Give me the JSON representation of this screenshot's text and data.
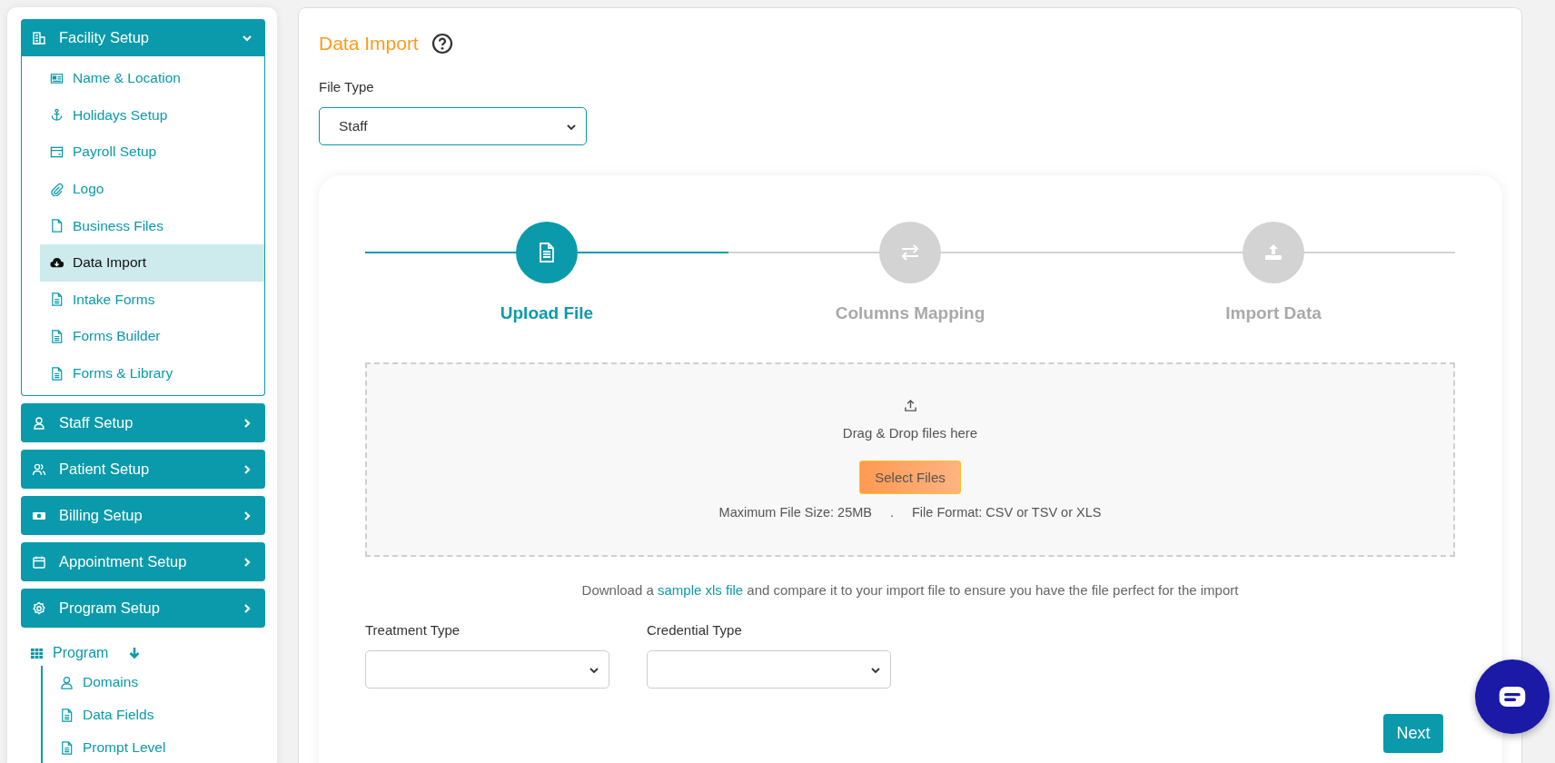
{
  "sidebar": {
    "sections": [
      {
        "label": "Facility Setup",
        "expanded": true,
        "items": [
          {
            "label": "Name & Location",
            "selected": false
          },
          {
            "label": "Holidays Setup",
            "selected": false
          },
          {
            "label": "Payroll Setup",
            "selected": false
          },
          {
            "label": "Logo",
            "selected": false
          },
          {
            "label": "Business Files",
            "selected": false
          },
          {
            "label": "Data Import",
            "selected": true
          },
          {
            "label": "Intake Forms",
            "selected": false
          },
          {
            "label": "Forms Builder",
            "selected": false
          },
          {
            "label": "Forms & Library",
            "selected": false
          }
        ]
      },
      {
        "label": "Staff Setup",
        "expanded": false
      },
      {
        "label": "Patient Setup",
        "expanded": false
      },
      {
        "label": "Billing Setup",
        "expanded": false
      },
      {
        "label": "Appointment Setup",
        "expanded": false
      },
      {
        "label": "Program Setup",
        "expanded": false
      }
    ],
    "program_tree": {
      "label": "Program",
      "expanded": true,
      "children": [
        {
          "label": "Domains"
        },
        {
          "label": "Data Fields"
        },
        {
          "label": "Prompt Level"
        }
      ]
    }
  },
  "page": {
    "title": "Data Import",
    "file_type": {
      "label": "File Type",
      "value": "Staff"
    }
  },
  "steps": [
    {
      "label": "Upload File",
      "active": true
    },
    {
      "label": "Columns Mapping",
      "active": false
    },
    {
      "label": "Import Data",
      "active": false
    }
  ],
  "dropzone": {
    "text": "Drag & Drop files here",
    "button": "Select Files",
    "max_size": "Maximum File Size: 25MB",
    "separator": ".",
    "formats": "File Format: CSV or TSV or XLS"
  },
  "download_note": {
    "before": "Download a",
    "link": "sample xls file",
    "after": "and compare it to your import file to ensure you have the file perfect for the import"
  },
  "fields": [
    {
      "label": "Treatment Type"
    },
    {
      "label": "Credential Type"
    }
  ],
  "next_button": "Next"
}
